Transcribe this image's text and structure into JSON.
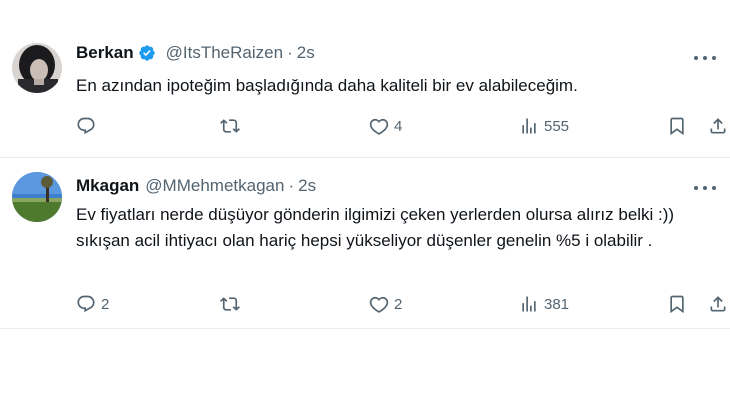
{
  "tweets": [
    {
      "name": "Berkan",
      "verified": true,
      "handle": "@ItsTheRaizen",
      "separator": "·",
      "time": "2s",
      "text": "En azından ipoteğim başladığında daha kaliteli bir ev alabileceğim.",
      "replies": "",
      "retweets": "",
      "likes": "4",
      "views": "555"
    },
    {
      "name": "Mkagan",
      "verified": false,
      "handle": "@MMehmetkagan",
      "separator": "·",
      "time": "2s",
      "text": "Ev fiyatları nerde düşüyor gönderin ilgimizi çeken yerlerden olursa alırız belki :)) sıkışan acil ihtiyacı olan hariç hepsi yükseliyor düşenler genelin  %5 i olabilir .",
      "replies": "2",
      "retweets": "",
      "likes": "2",
      "views": "381"
    }
  ],
  "icons": {
    "verified": "verified-badge-icon",
    "more": "more-horizontal-icon",
    "reply": "reply-bubble-icon",
    "retweet": "retweet-icon",
    "like": "heart-icon",
    "views": "views-bar-chart-icon",
    "bookmark": "bookmark-icon",
    "share": "share-upload-icon"
  },
  "colors": {
    "verified": "#1d9bf0",
    "text": "#0f1419",
    "secondary": "#536471",
    "divider": "#e6ecf0"
  }
}
